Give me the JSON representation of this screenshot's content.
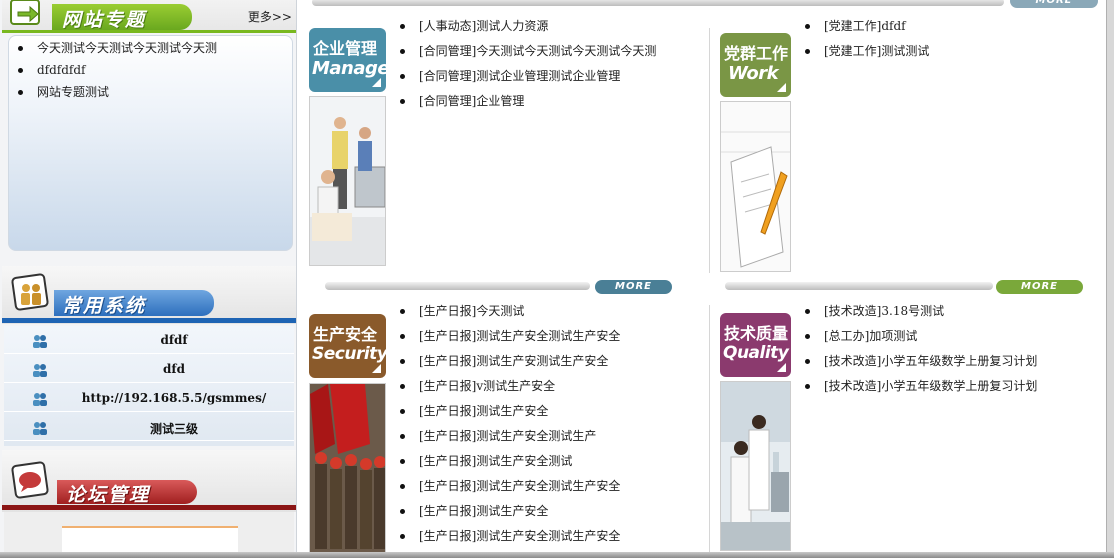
{
  "left": {
    "topics": {
      "title": "网站专题",
      "more": "更多>>",
      "items": [
        "今天测试今天测试今天测试今天测",
        "dfdfdfdf",
        "网站专题测试"
      ]
    },
    "systems": {
      "title": "常用系统",
      "items": [
        "dfdf",
        "dfd",
        "http://192.168.5.5/gsmmes/",
        "测试三级"
      ]
    },
    "forum": {
      "title": "论坛管理"
    }
  },
  "sections": {
    "enterprise": {
      "icon_zh": "企业管理",
      "icon_en": "Manage",
      "color": "#4a8fa8",
      "items": [
        "[人事动态]测试人力资源",
        "[合同管理]今天测试今天测试今天测试今天测",
        "[合同管理]测试企业管理测试企业管理",
        "[合同管理]企业管理"
      ]
    },
    "party": {
      "icon_zh": "党群工作",
      "icon_en": "Work",
      "color": "#7a9645",
      "items": [
        "[党建工作]dfdf",
        "[党建工作]测试测试"
      ]
    },
    "safety": {
      "icon_zh": "生产安全",
      "icon_en": "Security",
      "color": "#8a5a2b",
      "more": "MORE",
      "items": [
        "[生产日报]今天测试",
        "[生产日报]测试生产安全测试生产安全",
        "[生产日报]测试生产安测试生产安全",
        "[生产日报]v测试生产安全",
        "[生产日报]测试生产安全",
        "[生产日报]测试生产安全测试生产",
        "[生产日报]测试生产安全测试",
        "[生产日报]测试生产安全测试生产安全",
        "[生产日报]测试生产安全",
        "[生产日报]测试生产安全测试生产安全"
      ]
    },
    "quality": {
      "icon_zh": "技术质量",
      "icon_en": "Quality",
      "color": "#8b3a6e",
      "more": "MORE",
      "items": [
        "[技术改造]3.18号测试",
        "[总工办]加项测试",
        "[技术改造]小学五年级数学上册复习计划",
        "[技术改造]小学五年级数学上册复习计划"
      ]
    }
  },
  "top_more": "MORE",
  "colors": {
    "safety_more": "#4a7f96",
    "quality_more": "#7aa83a",
    "top_more": "#8aa8b8"
  }
}
